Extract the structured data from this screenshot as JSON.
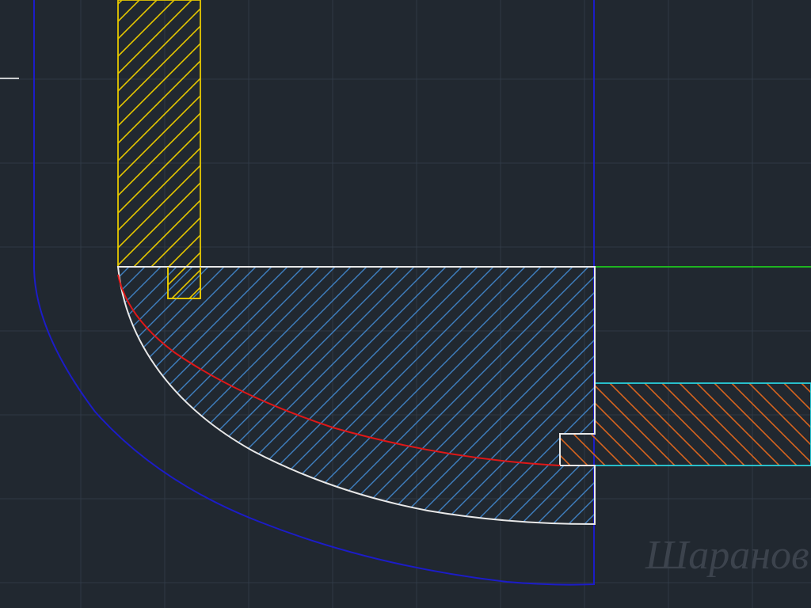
{
  "drawing": {
    "background_color": "#212830",
    "grid_color": "#2f3945",
    "colors": {
      "yellow_part": "#e6c800",
      "blue_boundary": "#1c1cc8",
      "white_outline": "#e8e8e8",
      "blue_hatch": "#3f7fc0",
      "red_curve": "#e01818",
      "green_line": "#1ec81e",
      "cyan_outline": "#2ad4e0",
      "orange_hatch": "#d8641e",
      "white_tick": "#ffffff"
    }
  },
  "watermark": {
    "text": "Шаранов",
    "color": "#3c434d"
  }
}
